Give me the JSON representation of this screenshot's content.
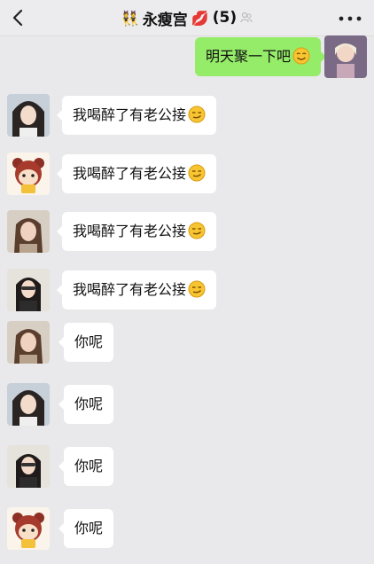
{
  "header": {
    "title": "永瘦宫",
    "member_count": "(5)",
    "title_emoji_left": "👯",
    "title_emoji_right": "💋"
  },
  "colors": {
    "accent_green": "#95ec69",
    "bubble_white": "#ffffff",
    "background": "#e9e9eb"
  },
  "messages": [
    {
      "sender": "me",
      "avatar": "avatar-me",
      "text": "明天聚一下吧",
      "emoji": "smile-icon"
    },
    {
      "sender": "member",
      "avatar": "avatar-girl-1",
      "text": "我喝醉了有老公接",
      "emoji": "smirk-icon"
    },
    {
      "sender": "member",
      "avatar": "avatar-cartoon-bear",
      "text": "我喝醉了有老公接",
      "emoji": "smirk-icon"
    },
    {
      "sender": "member",
      "avatar": "avatar-girl-2",
      "text": "我喝醉了有老公接",
      "emoji": "smirk-icon"
    },
    {
      "sender": "member",
      "avatar": "avatar-girl-3",
      "text": "我喝醉了有老公接",
      "emoji": "smirk-icon"
    },
    {
      "sender": "member",
      "avatar": "avatar-girl-2",
      "text": "你呢"
    },
    {
      "sender": "member",
      "avatar": "avatar-girl-1",
      "text": "你呢"
    },
    {
      "sender": "member",
      "avatar": "avatar-girl-3",
      "text": "你呢"
    },
    {
      "sender": "member",
      "avatar": "avatar-cartoon-bear",
      "text": "你呢"
    }
  ]
}
